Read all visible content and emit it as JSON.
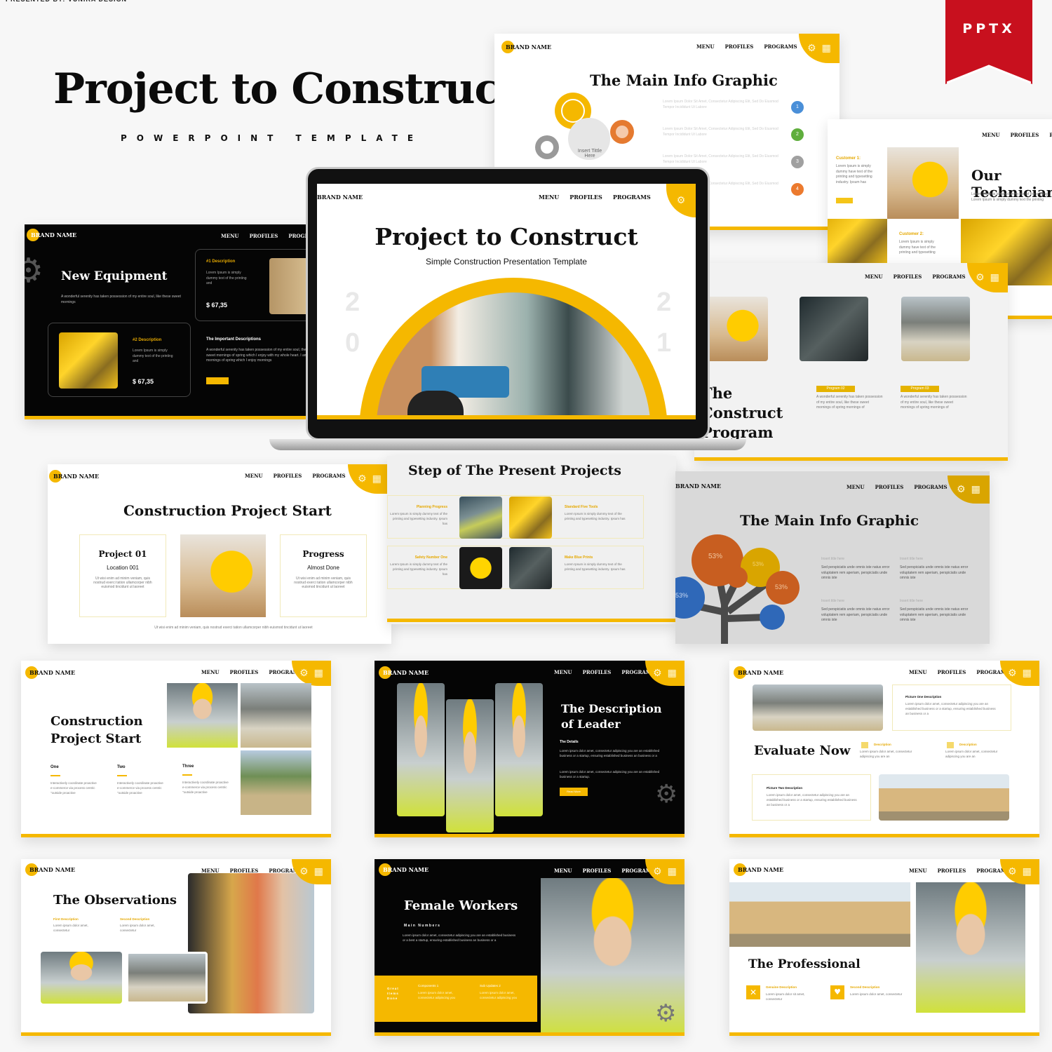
{
  "presenter": "PRESENTED BY: VUNIRA DESIGN",
  "hero": {
    "title": "Project to Construct",
    "subtitle": "POWERPOINT TEMPLATE"
  },
  "badge": {
    "label": "PPTX",
    "color": "#c8101e"
  },
  "common": {
    "brand": "BRAND NAME",
    "nav": [
      "MENU",
      "PROFILES",
      "PROGRAMS"
    ],
    "accent": "#f5b800"
  },
  "slides": {
    "infographic_gears": {
      "title": "The Main Info Graphic",
      "center_label": "Insert Tittle Here",
      "items": [
        {
          "num": "1",
          "color": "#4a8fd8",
          "text": "Lorem Ipsum Dolor Sit Amet, Consectetur Adipiscing Elit, Sed Do Eiusmod Tempor Incididunt Ut Labore"
        },
        {
          "num": "2",
          "color": "#5fae3d",
          "text": "Lorem Ipsum Dolor Sit Amet, Consectetur Adipiscing Elit, Sed Do Eiusmod Tempor Incididunt Ut Labore"
        },
        {
          "num": "3",
          "color": "#a0a0a0",
          "text": "Lorem Ipsum Dolor Sit Amet, Consectetur Adipiscing Elit, Sed Do Eiusmod Tempor Incididunt Ut Labore"
        },
        {
          "num": "4",
          "color": "#ec7a2e",
          "text": "Lorem Ipsum Dolor Sit Amet, Consectetur Adipiscing Elit, Sed Do Eiusmod Tempor Incididunt Ut Labore"
        }
      ]
    },
    "new_equipment": {
      "title": "New Equipment",
      "intro": "A wonderful serenity has taken possession of my entire soul, like these sweet mornings",
      "card1": {
        "label": "#1 Description",
        "text": "Lorem Ipsum is simply dummy text of the printing and",
        "price": "$ 67,35"
      },
      "card2": {
        "label": "#2 Description",
        "text": "Lorem Ipsum is simply dummy text of the printing and",
        "price": "$ 67,35"
      },
      "important": {
        "title": "The Important Descriptions",
        "text": "A wonderful serenity has taken possession of my entire soul, these sweet mornings of spring which I enjoy with my whole heart. I am mornings of spring which I enjoy mornings"
      }
    },
    "cover": {
      "title": "Project to Construct",
      "subtitle": "Simple Construction Presentation Template",
      "year_left": [
        "2",
        "0"
      ],
      "year_right": [
        "2",
        "1"
      ]
    },
    "technicians": {
      "title": "Our Technicians",
      "text": "Lorem Ipsum is simply dummy text of the printing. Lorem Ipsum is simply dummy text the printing",
      "customer1": {
        "label": "Customer 1:",
        "text": "Lorem Ipsum is simply dummy have text of the printing and typesetting industry. Ipsum has"
      },
      "customer2": {
        "label": "Customer 2:",
        "text": "Lorem Ipsum is simply dummy have text of the printing and typesetting"
      }
    },
    "program": {
      "title": "The Construct Program",
      "items": [
        {
          "label": "Program 02",
          "text": "A wonderful serenity has taken possession of my entire soul, like these sweet mornings of spring mornings of"
        },
        {
          "label": "Program 03",
          "text": "A wonderful serenity has taken possession of my entire soul, like these sweet mornings of spring mornings of"
        }
      ]
    },
    "project_start": {
      "title": "Construction Project Start",
      "left": {
        "title": "Project 01",
        "sub": "Location 001",
        "text": "Ut wisi enim ad minim veniam, quis nostrud exerci tation ullamcorper nibh euismod tincidunt ut laoreet"
      },
      "right": {
        "title": "Progress",
        "sub": "Almost Done",
        "text": "Ut wisi enim ad minim veniam, quis nostrud exerci tation ullamcorper nibh euismod tincidunt ut laoreet"
      },
      "footer": "Ut wisi enim ad minim veniam, quis nostrud exerci tation ullamcorper nibh euismod tincidunt ut laoreet"
    },
    "steps": {
      "title": "Step of The Present Projects",
      "items": [
        {
          "label": "Planning Progress",
          "text": "Lorem Ipsum is simply dummy text of the printing and typesetting industry. Ipsum has"
        },
        {
          "label": "Standard Five Tools",
          "text": "Lorem Ipsum is simply dummy text of the printing and typesetting industry. Ipsum has"
        },
        {
          "label": "Safety Number One",
          "text": "Lorem Ipsum is simply dummy text of the printing and typesetting industry. Ipsum has"
        },
        {
          "label": "Make Blue Prints",
          "text": "Lorem Ipsum is simply dummy text of the printing and typesetting industry. Ipsum has"
        }
      ]
    },
    "infographic_tree": {
      "title": "The Main Info Graphic",
      "bubbles": [
        "53%",
        "53%",
        "53%",
        "53%"
      ],
      "items": [
        {
          "label": "Insert title here",
          "text": "Sed perspiciatis unde omnis iste natus error voluptatem rem aperiam, perspiciatis unde omnis iste"
        },
        {
          "label": "Insert title here",
          "text": "Sed perspiciatis unde omnis iste natus error voluptatem rem aperiam, perspiciatis unde omnis iste"
        },
        {
          "label": "Insert title here",
          "text": "Sed perspiciatis unde omnis iste natus error voluptatem rem aperiam, perspiciatis unde omnis iste"
        },
        {
          "label": "Insert title here",
          "text": "Sed perspiciatis unde omnis iste natus error voluptatem rem aperiam, perspiciatis unde omnis iste"
        }
      ]
    },
    "cps2": {
      "title_line1": "Construction",
      "title_line2": "Project Start",
      "cols": [
        {
          "label": "One",
          "text": "Interactively coordinate proactive e-commerce via process centric \"outside proactive"
        },
        {
          "label": "Two",
          "text": "Interactively coordinate proactive e-commerce via process centric \"outside proactive"
        },
        {
          "label": "Three",
          "text": "Interactively coordinate proactive e-commerce via process centric \"outside proactive"
        }
      ]
    },
    "leader": {
      "title_line1": "The Description",
      "title_line2": "of Leader",
      "subhead": "The Details",
      "p1": "Lorem ipsum dolor amet, consectetur adipiscing you are an established business or a startup, ensuring established business an business or a",
      "p2": "Lorem ipsum dolor amet, consectetur adipiscing you are an established business or a startup.",
      "button": "Read More"
    },
    "evaluate": {
      "title": "Evaluate Now",
      "pic1": {
        "title": "Picture One Description",
        "text": "Lorem ipsum dolor amet, consectetur adipiscing you are an established business or a startup, ensuring established business an business or a"
      },
      "pic2": {
        "title": "Picture Two Description",
        "text": "Lorem ipsum dolor amet, consectetur adipiscing you are an established business or a startup, ensuring established business an business or a"
      },
      "mini": [
        {
          "label": "Description",
          "text": "Lorem ipsum dolor amet, consectetur adipiscing you are an"
        },
        {
          "label": "Description",
          "text": "Lorem ipsum dolor amet, consectetur adipiscing you are an"
        }
      ]
    },
    "observations": {
      "title": "The Observations",
      "items": [
        {
          "label": "First Description",
          "text": "Lorem ipsum dolor amet, consectetur"
        },
        {
          "label": "Second Description",
          "text": "Lorem ipsum dolor amet, consectetur"
        }
      ]
    },
    "female": {
      "title": "Female Workers",
      "subhead": "Main Numbers",
      "text": "Lorem ipsum dolor amet, consectetur adipiscing you are an established business or a best a startup, ensuring established business an business or a",
      "band_label": "Great Items Done",
      "components": [
        {
          "label": "Components 1",
          "text": "Lorem ipsum dolor amet, consectetur adipiscing you"
        },
        {
          "label": "Sub Updates 2",
          "text": "Lorem ipsum dolor amet, consectetur adipiscing you"
        }
      ]
    },
    "professional": {
      "title": "The Professional",
      "items": [
        {
          "label": "Genuine Description",
          "text": "Lorem ipsum dolor sit amet, consectetur",
          "icon": "tools-icon"
        },
        {
          "label": "Second Description",
          "text": "Lorem ipsum dolor amet, consectetur",
          "icon": "heart-icon"
        }
      ]
    }
  }
}
